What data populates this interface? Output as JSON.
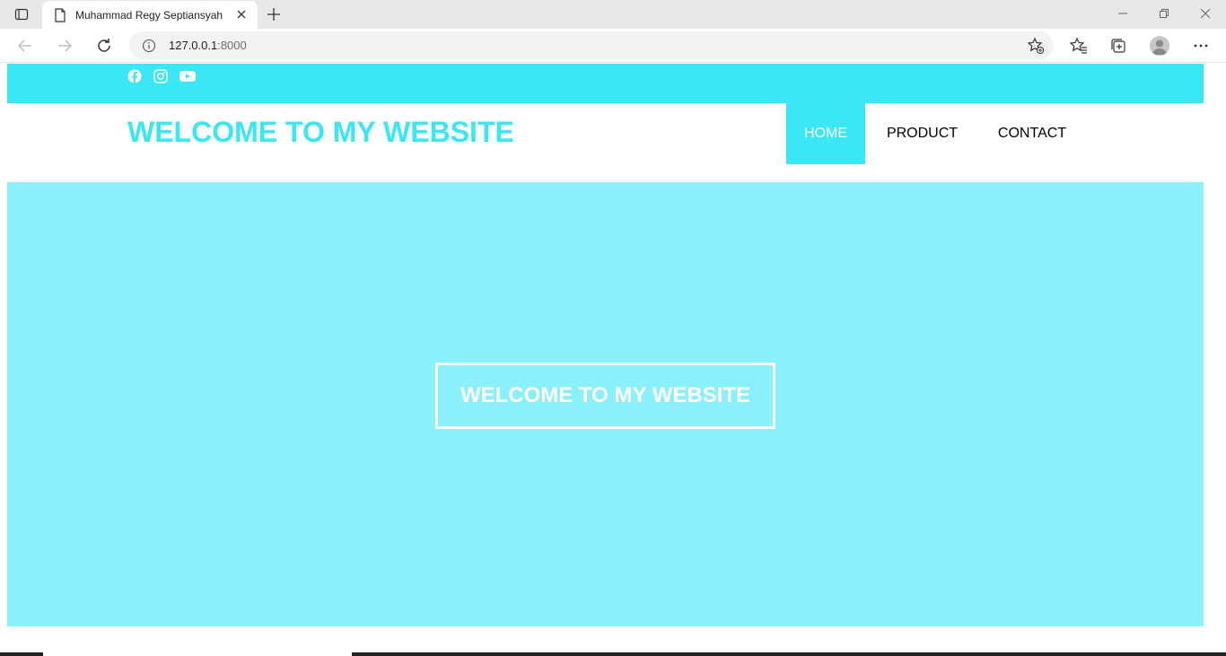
{
  "browser": {
    "tab_title": "Muhammad Regy Septiansyah",
    "url_host": "127.0.0.1",
    "url_port": ":8000"
  },
  "icons": {
    "tab_actions": "tab-actions-icon",
    "page": "page-icon",
    "close": "close-icon",
    "new_tab": "plus-icon",
    "back": "back-arrow-icon",
    "forward": "forward-arrow-icon",
    "refresh": "refresh-icon",
    "info": "info-icon",
    "favorite_add": "star-plus-icon",
    "favorites": "favorites-icon",
    "collections": "collections-icon",
    "profile": "profile-icon",
    "more": "ellipsis-icon",
    "social": [
      "facebook-icon",
      "instagram-icon",
      "youtube-icon"
    ]
  },
  "site": {
    "brand": "WELCOME TO MY WEBSITE",
    "nav": [
      {
        "label": "HOME",
        "active": true
      },
      {
        "label": "PRODUCT",
        "active": false
      },
      {
        "label": "CONTACT",
        "active": false
      }
    ],
    "hero_text": "WELCOME TO MY WEBSITE"
  },
  "colors": {
    "accent": "#3ae7f5",
    "hero_bg": "#8af0fa",
    "text": "#000000",
    "white": "#ffffff"
  }
}
